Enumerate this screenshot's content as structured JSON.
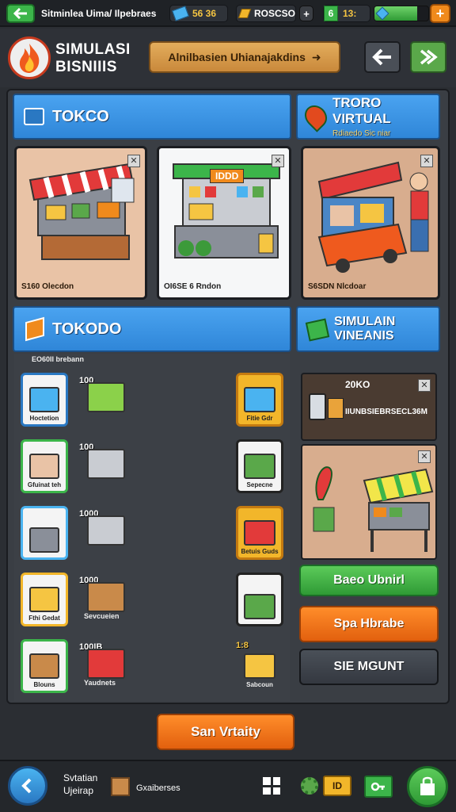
{
  "topbar": {
    "back_icon": "arrow-left-icon",
    "breadcrumb": "Sitminlea Uima/ Ilpebraes",
    "currency1": "56 36",
    "currency2": "ROSCSO",
    "plus_small": "+",
    "level_badge": "6",
    "level_value": "13:",
    "energy_fill": 0.8,
    "plus_button": "+"
  },
  "header": {
    "logo_line1": "SIMULASI",
    "logo_line2": "BISNIIIS",
    "banner_text": "Alnilbasien Uhianajakdins",
    "banner_arrow": "➜",
    "undo_icon": "back-arrow-icon",
    "next_icon": "double-chevron-right-icon"
  },
  "sections": {
    "toko_title": "TOKCO",
    "toko_virtual_title": "TRORO VIRTUAL",
    "toko_virtual_sub": "Rdiaedo Sic niar",
    "tokodo_title": "TOKODO",
    "simulasi_title_1": "SIMULAIN",
    "simulasi_title_2": "VINEANIS"
  },
  "shop_cards": [
    {
      "caption": "S160 Olecdon"
    },
    {
      "caption": "OI6SE 6 Rndon",
      "sign": "IDDD"
    },
    {
      "caption": "S6SDN Nlcdoar"
    }
  ],
  "inventory": {
    "label": "EO60II brebann",
    "left_tiles": [
      {
        "label": "Hoctetion",
        "qty": "100"
      },
      {
        "label": "Gfuinat teh",
        "qty": "100"
      },
      {
        "label": "",
        "qty": "1000"
      },
      {
        "label": "Fthi Gedat",
        "qty": "1000"
      },
      {
        "label": "Blouns",
        "qty": "100IB"
      }
    ],
    "mid_labels": [
      "",
      "",
      "",
      "Sevcueien",
      "Yaudnets"
    ],
    "right_tiles": [
      {
        "label": "Fitie Gdr"
      },
      {
        "label": "Sepecne"
      },
      {
        "label": "Betuis Guds"
      },
      {
        "label": ""
      },
      {
        "label": "Sabcoun",
        "qty": "1:8"
      }
    ]
  },
  "side_cards": {
    "card1_title": "20KO",
    "card1_text": "IIUNBSIEBRSECL36M"
  },
  "actions": {
    "green": "Baeo Ubnirl",
    "orange": "Spa Hbrabe",
    "dark": "SIE MGUNT"
  },
  "main_button": "San Vrtaity",
  "bottombar": {
    "line1": "Svtatian",
    "line2": "Ujeirap",
    "box_label": "Gxaiberses",
    "grid_icon": "grid-icon",
    "gear_icon": "gear-icon",
    "coin_label": "ID",
    "key_icon": "key-icon",
    "shop_icon": "shopping-bag-icon"
  },
  "colors": {
    "accent_blue": "#3a94e6",
    "green": "#3cb54a",
    "orange": "#f07a1c",
    "dark": "#3c4149"
  }
}
